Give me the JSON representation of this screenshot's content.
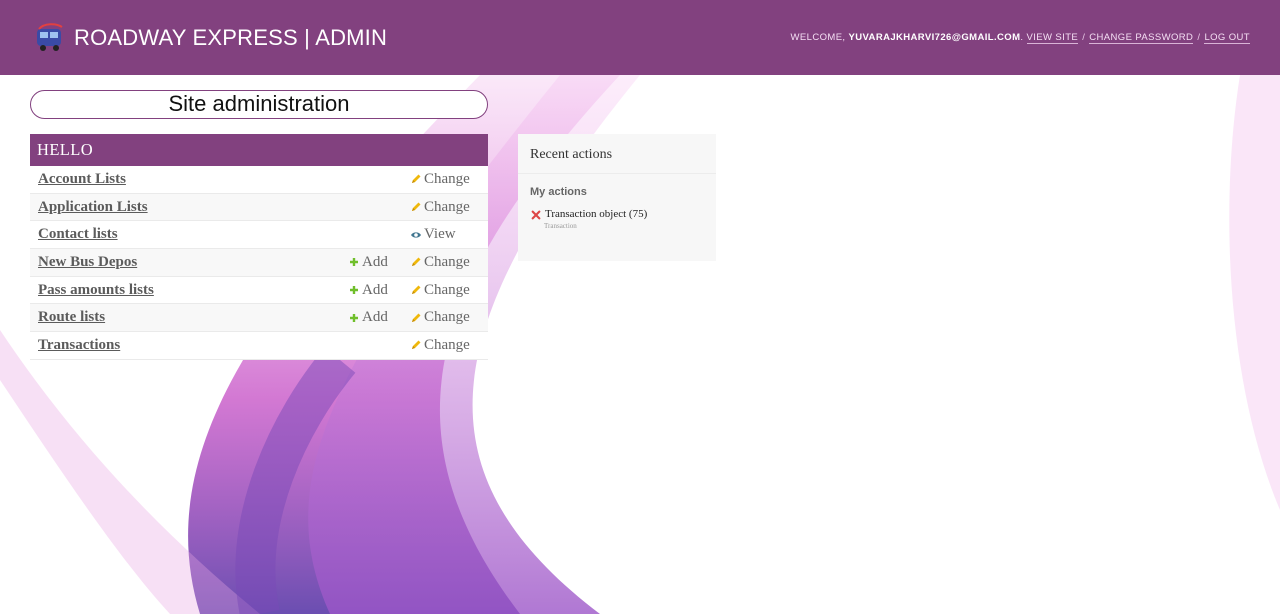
{
  "header": {
    "title": "ROADWAY EXPRESS | ADMIN",
    "welcome": "WELCOME,",
    "username": "YUVARAJKHARVI726@GMAIL.COM",
    "view_site": "VIEW SITE",
    "separator": "/",
    "change_password": "CHANGE PASSWORD",
    "log_out": "LOG OUT"
  },
  "page_title": "Site administration",
  "app_module": {
    "caption": "HELLO",
    "models": [
      {
        "name": "Account Lists",
        "add": "",
        "action": "Change"
      },
      {
        "name": "Application Lists",
        "add": "",
        "action": "Change"
      },
      {
        "name": "Contact lists",
        "add": "",
        "action": "View"
      },
      {
        "name": "New Bus Depos",
        "add": "Add",
        "action": "Change"
      },
      {
        "name": "Pass amounts lists",
        "add": "Add",
        "action": "Change"
      },
      {
        "name": "Route lists",
        "add": "Add",
        "action": "Change"
      },
      {
        "name": "Transactions",
        "add": "",
        "action": "Change"
      }
    ]
  },
  "recent_actions": {
    "title": "Recent actions",
    "subtitle": "My actions",
    "items": [
      {
        "label": "Transaction object (75)",
        "type": "Transaction",
        "icon": "delete-icon"
      }
    ]
  },
  "colors": {
    "header_bg": "#82417f",
    "add_icon": "#70bf2b",
    "change_icon": "#efb80b",
    "view_icon": "#417690",
    "delete_icon": "#dd4646"
  }
}
